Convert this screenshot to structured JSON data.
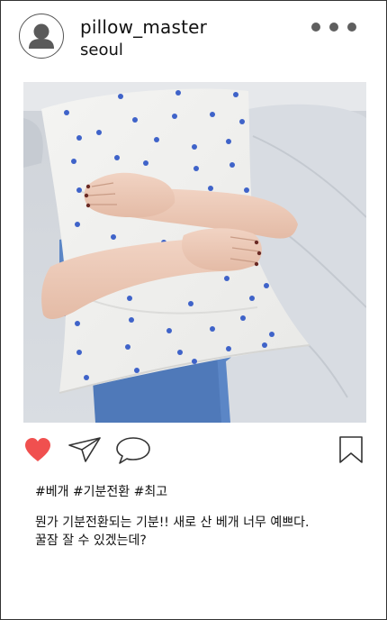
{
  "post": {
    "username": "pillow_master",
    "location": "seoul",
    "hashtags": "#베개 #기분전환 #최고",
    "caption_line1": "뭔가 기분전환되는 기분!! 새로 산 베개 너무 예쁘다.",
    "caption_line2": "꿀잠 잘 수 있겠는데?",
    "liked": true
  },
  "colors": {
    "like_heart": "#f0504f",
    "icon_stroke": "#333333",
    "more_dots": "#5f5f5f",
    "pillow_pattern": "#3f63c9",
    "shirt": "#5b86c6"
  },
  "icons": {
    "avatar": "person-silhouette-icon",
    "more": "more-dots-icon",
    "like": "heart-icon",
    "share": "paper-plane-icon",
    "comment": "speech-bubble-icon",
    "save": "bookmark-icon"
  }
}
